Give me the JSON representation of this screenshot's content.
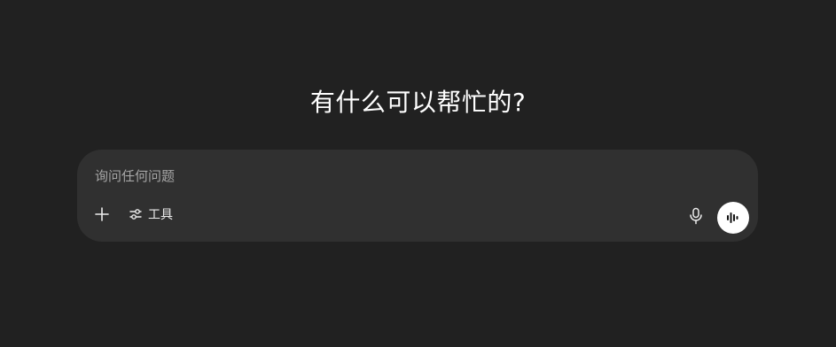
{
  "main": {
    "heading": "有什么可以帮忙的?"
  },
  "composer": {
    "input_placeholder": "询问任何问题",
    "input_value": "",
    "tools_label": "工具",
    "icons": {
      "attach": "plus-icon",
      "tools": "sliders-icon",
      "dictate": "microphone-icon",
      "voice": "voice-waveform-icon"
    }
  },
  "colors": {
    "background": "#212121",
    "composer_background": "#303030",
    "text": "#ffffff",
    "placeholder": "#a6a6a6",
    "voice_button": "#ffffff"
  }
}
